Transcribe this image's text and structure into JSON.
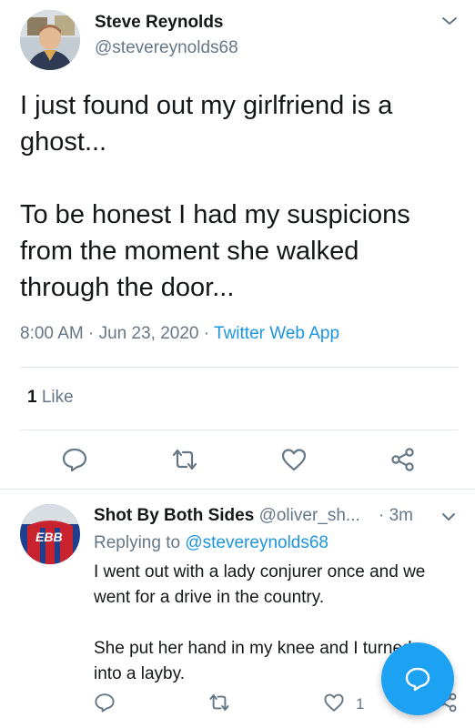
{
  "main_tweet": {
    "author_name": "Steve Reynolds",
    "author_handle": "@stevereynolds68",
    "text_line1": "I just found out my girlfriend is a",
    "text_line2": "ghost...",
    "text_line3": "To be honest I had my suspicions",
    "text_line4": "from the moment she walked",
    "text_line5": "through the door...",
    "time": "8:00 AM",
    "date": "Jun 23, 2020",
    "source": "Twitter Web App",
    "likes_count": "1",
    "likes_label": "Like",
    "icons": [
      "chevron-down-icon",
      "reply-icon",
      "retweet-icon",
      "like-icon",
      "share-icon"
    ]
  },
  "reply_tweet": {
    "author_name": "Shot By Both Sides",
    "author_handle": "@oliver_sh...",
    "time": "3m",
    "replying_label": "Replying to",
    "replying_handle": "@stevereynolds68",
    "text_line1": "I went out with a lady conjurer once and we",
    "text_line2": "went for a drive in the country.",
    "text_line3": "She put her hand in my knee and I turned",
    "text_line4": "into a layby.",
    "like_count": "1",
    "avatar_label": "EBB",
    "icons": [
      "chevron-down-icon",
      "reply-icon",
      "retweet-icon",
      "like-icon",
      "share-icon"
    ]
  },
  "separators": {
    "dot": "·"
  },
  "colors": {
    "accent": "#1b95e0",
    "fab": "#1da1f2",
    "secondary_text": "#657786",
    "primary_text": "#14171a",
    "divider": "#e1e8ed"
  }
}
